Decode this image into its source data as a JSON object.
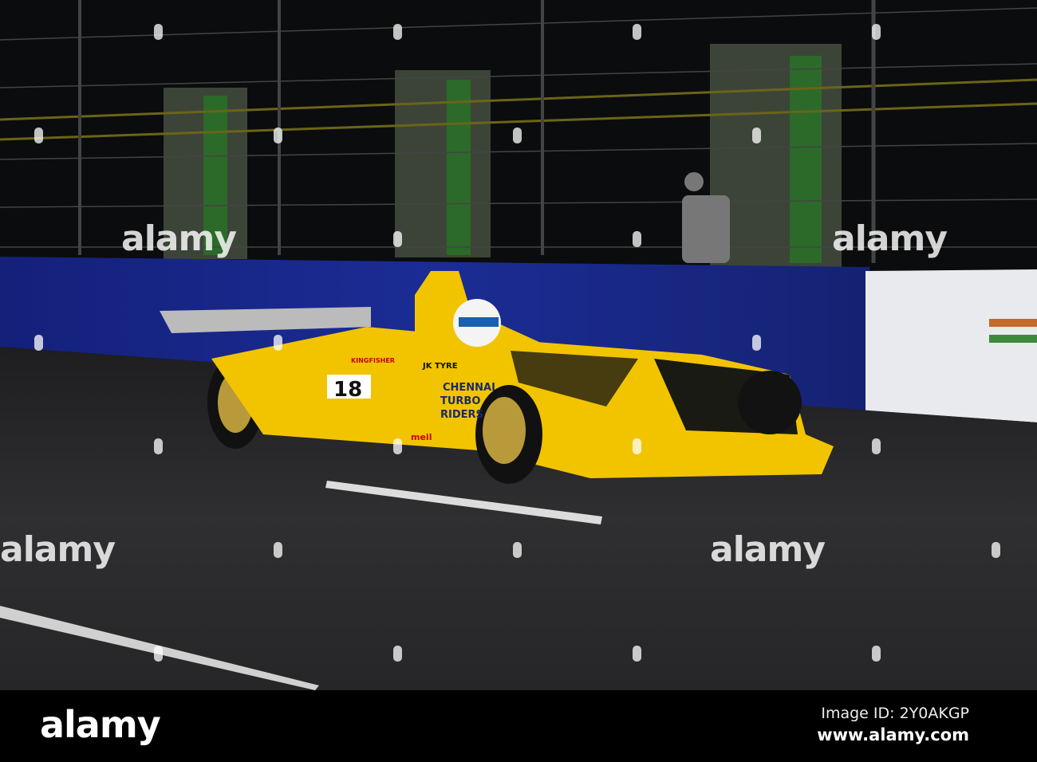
{
  "watermark": "alamy",
  "car": {
    "number": "18",
    "team_line1": "CHENNAI",
    "team_line2": "TURBO",
    "team_line3": "RIDERS",
    "sponsor_tyre": "JK TYRE",
    "sponsor_beer": "KINGFISHER",
    "sponsor_meil": "meil"
  },
  "footer": {
    "logo": "alamy",
    "image_id": "Image ID: 2Y0AKGP",
    "site": "www.alamy.com"
  },
  "colors": {
    "car": "#f2c400",
    "wall": "#1a2a8c",
    "road": "#2b2b2d"
  }
}
